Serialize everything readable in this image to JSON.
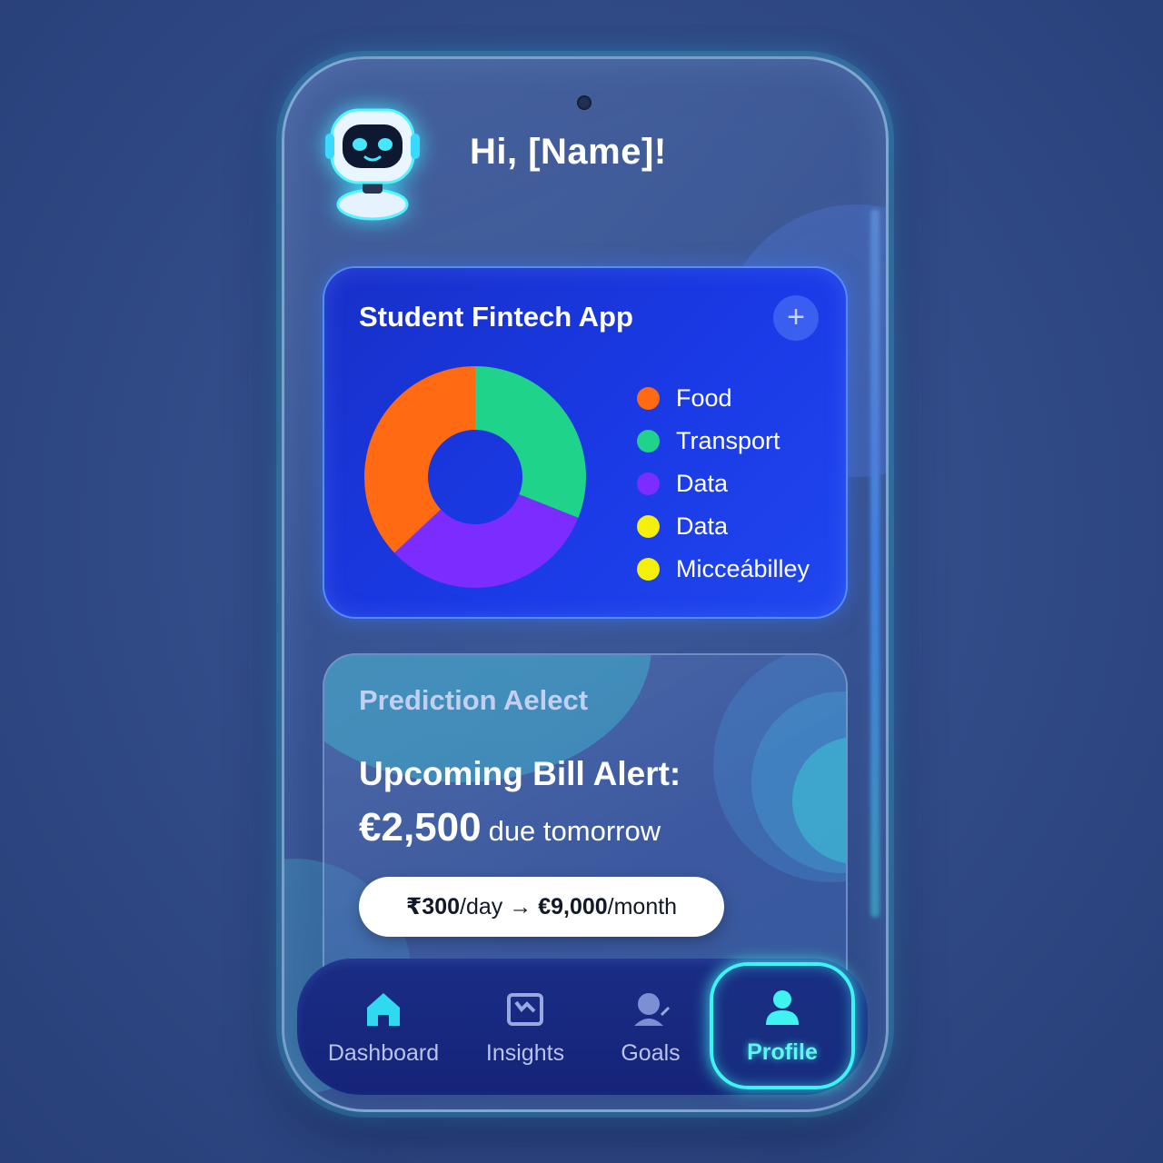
{
  "header": {
    "greeting": "Hi, [Name]!",
    "avatar_icon": "robot-icon"
  },
  "spending_card": {
    "title": "Student Fintech App",
    "add_icon": "plus-icon",
    "legend": [
      {
        "label": "Food",
        "color": "#ff6a13"
      },
      {
        "label": "Transport",
        "color": "#1fd38a"
      },
      {
        "label": "Data",
        "color": "#7b2cff"
      },
      {
        "label": "Data",
        "color": "#f4f00a"
      },
      {
        "label": "Micceábilley",
        "color": "#f4f00a"
      }
    ]
  },
  "chart_data": {
    "type": "pie",
    "series": [
      {
        "name": "Transport",
        "value": 31,
        "color": "#1fd38a"
      },
      {
        "name": "Data",
        "value": 32,
        "color": "#7b2cff"
      },
      {
        "name": "Food",
        "value": 37,
        "color": "#ff6a13"
      }
    ]
  },
  "prediction_card": {
    "subtitle": "Prediction Aelect",
    "headline": "Upcoming Bill Alert:",
    "amount": "€2,500",
    "amount_note": "due tomorrow",
    "pill": {
      "per_day_amount": "₹300",
      "per_day_unit": "/day",
      "arrow": "→",
      "per_month_amount": "€9,000",
      "per_month_unit": "/month"
    }
  },
  "nav": {
    "items": [
      {
        "label": "Dashboard",
        "icon": "home-icon",
        "active": false
      },
      {
        "label": "Insights",
        "icon": "insights-icon",
        "active": false
      },
      {
        "label": "Goals",
        "icon": "goals-icon",
        "active": false
      },
      {
        "label": "Profile",
        "icon": "profile-icon",
        "active": true
      }
    ]
  },
  "colors": {
    "accent_cyan": "#3ff3f0",
    "card_blue": "#1a3ae6",
    "background": "#304a86"
  }
}
